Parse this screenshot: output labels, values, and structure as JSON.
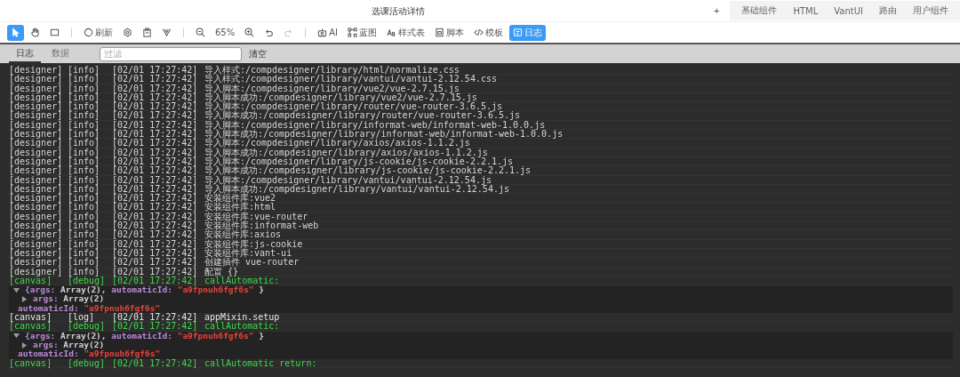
{
  "window": {
    "title": "选课活动详情"
  },
  "header_tabs": {
    "add": "+",
    "items": [
      {
        "label": "基础组件",
        "selected": false
      },
      {
        "label": "HTML",
        "selected": false
      },
      {
        "label": "VantUI",
        "selected": false
      },
      {
        "label": "路由",
        "selected": false
      },
      {
        "label": "用户组件",
        "selected": false
      }
    ]
  },
  "toolbar": {
    "groups": [
      [
        {
          "selected": true,
          "disabled": false
        },
        {
          "selected": false,
          "disabled": false
        },
        {
          "selected": false,
          "disabled": false
        }
      ],
      [
        {
          "label": "刷新",
          "selected": false,
          "disabled": false
        },
        {
          "selected": false,
          "disabled": false
        },
        {
          "selected": false,
          "disabled": false
        },
        {
          "selected": false,
          "disabled": false
        }
      ],
      [
        {
          "selected": false,
          "disabled": false
        },
        {
          "label": "65%",
          "selected": false,
          "disabled": false
        },
        {
          "selected": false,
          "disabled": false
        },
        {
          "selected": false,
          "disabled": false
        },
        {
          "selected": false,
          "disabled": true
        }
      ],
      [
        {
          "label": "AI",
          "selected": false,
          "disabled": false
        },
        {
          "label": "蓝图",
          "selected": false,
          "disabled": false
        },
        {
          "label": "样式表",
          "selected": false,
          "disabled": false
        },
        {
          "label": "脚本",
          "selected": false,
          "disabled": false
        },
        {
          "label": "模板",
          "selected": false,
          "disabled": false
        },
        {
          "label": "日志",
          "selected": true,
          "disabled": false
        }
      ]
    ]
  },
  "log_panel": {
    "tabs": [
      {
        "label": "日志",
        "selected": true
      },
      {
        "label": "数据",
        "selected": false
      }
    ],
    "filter": {
      "placeholder": "过滤"
    },
    "clear_button": "清空",
    "rows": [
      {
        "kind": "entry",
        "color": "#d6d6d6",
        "source": "[designer]",
        "severity": "[info]",
        "time": "[02/01 17:27:42]",
        "message": "导入样式:/compdesigner/library/html/normalize.css"
      },
      {
        "kind": "entry",
        "color": "#d6d6d6",
        "source": "[designer]",
        "severity": "[info]",
        "time": "[02/01 17:27:42]",
        "message": "导入样式:/compdesigner/library/vantui/vantui-2.12.54.css"
      },
      {
        "kind": "entry",
        "color": "#d6d6d6",
        "source": "[designer]",
        "severity": "[info]",
        "time": "[02/01 17:27:42]",
        "message": "导入脚本:/compdesigner/library/vue2/vue-2.7.15.js"
      },
      {
        "kind": "entry",
        "color": "#d6d6d6",
        "source": "[designer]",
        "severity": "[info]",
        "time": "[02/01 17:27:42]",
        "message": "导入脚本成功:/compdesigner/library/vue2/vue-2.7.15.js"
      },
      {
        "kind": "entry",
        "color": "#d6d6d6",
        "source": "[designer]",
        "severity": "[info]",
        "time": "[02/01 17:27:42]",
        "message": "导入脚本:/compdesigner/library/router/vue-router-3.6.5.js"
      },
      {
        "kind": "entry",
        "color": "#d6d6d6",
        "source": "[designer]",
        "severity": "[info]",
        "time": "[02/01 17:27:42]",
        "message": "导入脚本成功:/compdesigner/library/router/vue-router-3.6.5.js"
      },
      {
        "kind": "entry",
        "color": "#d6d6d6",
        "source": "[designer]",
        "severity": "[info]",
        "time": "[02/01 17:27:42]",
        "message": "导入脚本:/compdesigner/library/informat-web/informat-web-1.0.0.js"
      },
      {
        "kind": "entry",
        "color": "#d6d6d6",
        "source": "[designer]",
        "severity": "[info]",
        "time": "[02/01 17:27:42]",
        "message": "导入脚本成功:/compdesigner/library/informat-web/informat-web-1.0.0.js"
      },
      {
        "kind": "entry",
        "color": "#d6d6d6",
        "source": "[designer]",
        "severity": "[info]",
        "time": "[02/01 17:27:42]",
        "message": "导入脚本:/compdesigner/library/axios/axios-1.1.2.js"
      },
      {
        "kind": "entry",
        "color": "#d6d6d6",
        "source": "[designer]",
        "severity": "[info]",
        "time": "[02/01 17:27:42]",
        "message": "导入脚本成功:/compdesigner/library/axios/axios-1.1.2.js"
      },
      {
        "kind": "entry",
        "color": "#d6d6d6",
        "source": "[designer]",
        "severity": "[info]",
        "time": "[02/01 17:27:42]",
        "message": "导入脚本:/compdesigner/library/js-cookie/js-cookie-2.2.1.js"
      },
      {
        "kind": "entry",
        "color": "#d6d6d6",
        "source": "[designer]",
        "severity": "[info]",
        "time": "[02/01 17:27:42]",
        "message": "导入脚本成功:/compdesigner/library/js-cookie/js-cookie-2.2.1.js"
      },
      {
        "kind": "entry",
        "color": "#d6d6d6",
        "source": "[designer]",
        "severity": "[info]",
        "time": "[02/01 17:27:42]",
        "message": "导入脚本:/compdesigner/library/vantui/vantui-2.12.54.js"
      },
      {
        "kind": "entry",
        "color": "#d6d6d6",
        "source": "[designer]",
        "severity": "[info]",
        "time": "[02/01 17:27:42]",
        "message": "导入脚本成功:/compdesigner/library/vantui/vantui-2.12.54.js"
      },
      {
        "kind": "entry",
        "color": "#d6d6d6",
        "source": "[designer]",
        "severity": "[info]",
        "time": "[02/01 17:27:42]",
        "message": "安装组件库:vue2"
      },
      {
        "kind": "entry",
        "color": "#d6d6d6",
        "source": "[designer]",
        "severity": "[info]",
        "time": "[02/01 17:27:42]",
        "message": "安装组件库:html"
      },
      {
        "kind": "entry",
        "color": "#d6d6d6",
        "source": "[designer]",
        "severity": "[info]",
        "time": "[02/01 17:27:42]",
        "message": "安装组件库:vue-router"
      },
      {
        "kind": "entry",
        "color": "#d6d6d6",
        "source": "[designer]",
        "severity": "[info]",
        "time": "[02/01 17:27:42]",
        "message": "安装组件库:informat-web"
      },
      {
        "kind": "entry",
        "color": "#d6d6d6",
        "source": "[designer]",
        "severity": "[info]",
        "time": "[02/01 17:27:42]",
        "message": "安装组件库:axios"
      },
      {
        "kind": "entry",
        "color": "#d6d6d6",
        "source": "[designer]",
        "severity": "[info]",
        "time": "[02/01 17:27:42]",
        "message": "安装组件库:js-cookie"
      },
      {
        "kind": "entry",
        "color": "#d6d6d6",
        "source": "[designer]",
        "severity": "[info]",
        "time": "[02/01 17:27:42]",
        "message": "安装组件库:vant-ui"
      },
      {
        "kind": "entry",
        "color": "#d6d6d6",
        "source": "[designer]",
        "severity": "[info]",
        "time": "[02/01 17:27:42]",
        "message": "创建插件 vue-router"
      },
      {
        "kind": "entry",
        "color": "#d6d6d6",
        "source": "[designer]",
        "severity": "[info]",
        "time": "[02/01 17:27:42]",
        "message": "配置 {}"
      },
      {
        "kind": "entry",
        "color": "#3fd94c",
        "source": "[canvas]",
        "severity": "[debug]",
        "time": "[02/01 17:27:42]",
        "message": "callAutomatic:"
      },
      {
        "kind": "object",
        "expanded": true,
        "summary": [
          {
            "text": "{args:",
            "color": "#b98bd8"
          },
          {
            "text": "Array(2),",
            "color": "#d0d0d0"
          },
          {
            "text": "automaticId:",
            "color": "#b98bd8"
          },
          {
            "text": "\"a9fpnuh6fgf6s\"",
            "color": "#e8433b"
          },
          {
            "text": "}",
            "color": "#d0d0d0"
          }
        ],
        "children": [
          {
            "key": "args:",
            "value": "Array(2)",
            "color": "#d0d0d0",
            "expanded": false
          },
          {
            "key": "automaticId:",
            "value": "\"a9fpnuh6fgf6s\"",
            "color": "#e8433b"
          }
        ]
      },
      {
        "kind": "entry",
        "color": "#e6e6e6",
        "source": "[canvas]",
        "severity": "[log]",
        "time": "[02/01 17:27:42]",
        "message": "appMixin.setup"
      },
      {
        "kind": "entry",
        "color": "#3fd94c",
        "source": "[canvas]",
        "severity": "[debug]",
        "time": "[02/01 17:27:42]",
        "message": "callAutomatic:"
      },
      {
        "kind": "object",
        "expanded": true,
        "summary": [
          {
            "text": "{args:",
            "color": "#b98bd8"
          },
          {
            "text": "Array(2),",
            "color": "#d0d0d0"
          },
          {
            "text": "automaticId:",
            "color": "#b98bd8"
          },
          {
            "text": "\"a9fpnuh6fgf6s\"",
            "color": "#e8433b"
          },
          {
            "text": "}",
            "color": "#d0d0d0"
          }
        ],
        "children": [
          {
            "key": "args:",
            "value": "Array(2)",
            "color": "#d0d0d0",
            "expanded": false
          },
          {
            "key": "automaticId:",
            "value": "\"a9fpnuh6fgf6s\"",
            "color": "#e8433b"
          }
        ]
      },
      {
        "kind": "entry",
        "color": "#3fd94c",
        "source": "[canvas]",
        "severity": "[debug]",
        "time": "[02/01 17:27:42]",
        "message": "callAutomatic return:"
      }
    ]
  }
}
